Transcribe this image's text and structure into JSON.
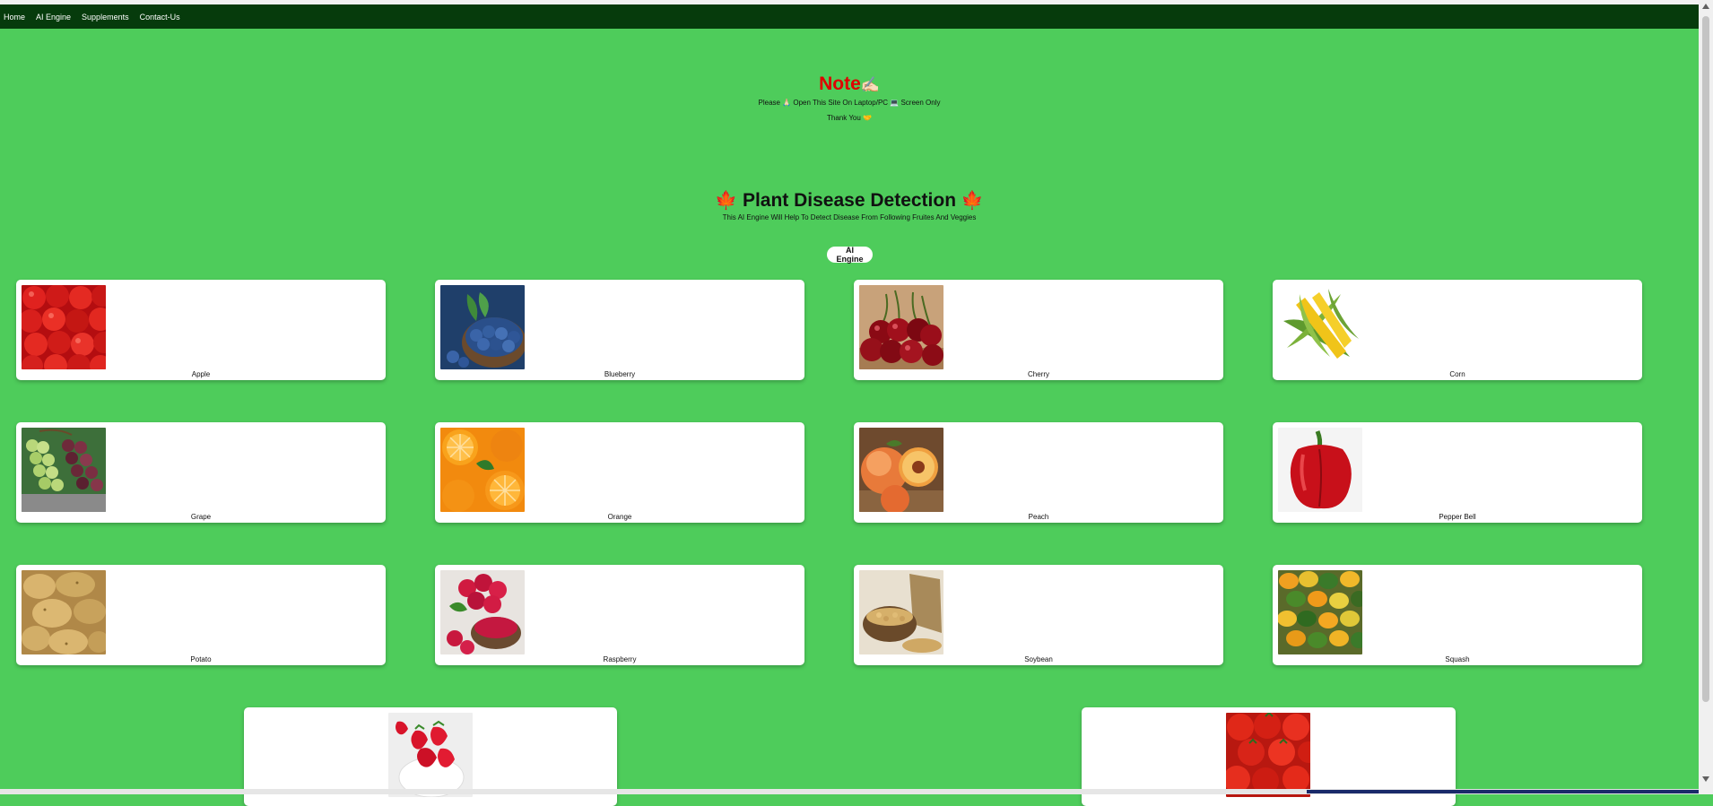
{
  "nav": {
    "items": [
      {
        "label": "Home"
      },
      {
        "label": "AI Engine"
      },
      {
        "label": "Supplements"
      },
      {
        "label": "Contact-Us"
      }
    ]
  },
  "note": {
    "title": "Note",
    "title_emoji": "✍🏻",
    "line1": "Please 🙏🏻 Open This Site On Laptop/PC 💻 Screen Only",
    "line2": "Thank You 🤝"
  },
  "hero": {
    "title": "Plant Disease Detection",
    "leaf_icon": "🍁",
    "subtitle": "This AI Engine Will Help To Detect Disease From Following Fruites And Veggies",
    "button_label": "AI Engine"
  },
  "items": [
    {
      "label": "Apple",
      "icon": "apple-image"
    },
    {
      "label": "Blueberry",
      "icon": "blueberry-image"
    },
    {
      "label": "Cherry",
      "icon": "cherry-image"
    },
    {
      "label": "Corn",
      "icon": "corn-image"
    },
    {
      "label": "Grape",
      "icon": "grape-image"
    },
    {
      "label": "Orange",
      "icon": "orange-image"
    },
    {
      "label": "Peach",
      "icon": "peach-image"
    },
    {
      "label": "Pepper Bell",
      "icon": "pepper-bell-image"
    },
    {
      "label": "Potato",
      "icon": "potato-image"
    },
    {
      "label": "Raspberry",
      "icon": "raspberry-image"
    },
    {
      "label": "Soybean",
      "icon": "soybean-image"
    },
    {
      "label": "Squash",
      "icon": "squash-image"
    }
  ],
  "colors": {
    "background": "#4ecc5b",
    "navbar": "#063b0c",
    "note_title": "#e00000"
  }
}
